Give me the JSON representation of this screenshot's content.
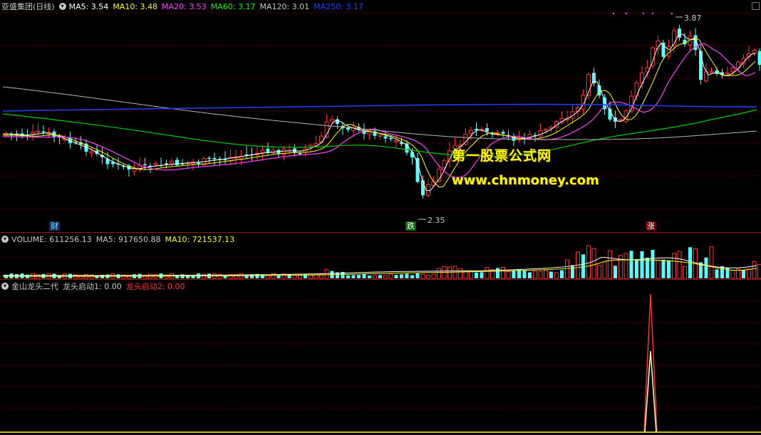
{
  "main": {
    "title": "亚盛集团(日线)",
    "ma": [
      {
        "label": "MA5: 3.54",
        "color": "#ffffff"
      },
      {
        "label": "MA10: 3.48",
        "color": "#ffff00"
      },
      {
        "label": "MA20: 3.53",
        "color": "#ff40ff"
      },
      {
        "label": "MA60: 3.17",
        "color": "#00ff00"
      },
      {
        "label": "MA120: 3.01",
        "color": "#c8c8c8"
      },
      {
        "label": "MA250: 3.17",
        "color": "#2040ff"
      }
    ],
    "high_label": "3.87",
    "low_label": "2.35",
    "tags": {
      "cai": "财",
      "die": "跌",
      "zhang": "涨"
    },
    "watermark_line1": "第一股票公式网",
    "watermark_line2": "www.chnmoney.com"
  },
  "volume": {
    "title": "VOLUME: 611256.13",
    "ma5": "MA5: 917650.88",
    "ma10": "MA10: 721537.13"
  },
  "indicator": {
    "title": "金山龙头二代",
    "l1": "龙头启动1: 0.00",
    "l2": "龙头启动2: 0.00"
  },
  "colors": {
    "up": "#ff3232",
    "down": "#54ffff",
    "grid": "#7a0000",
    "border": "#a01010"
  }
}
